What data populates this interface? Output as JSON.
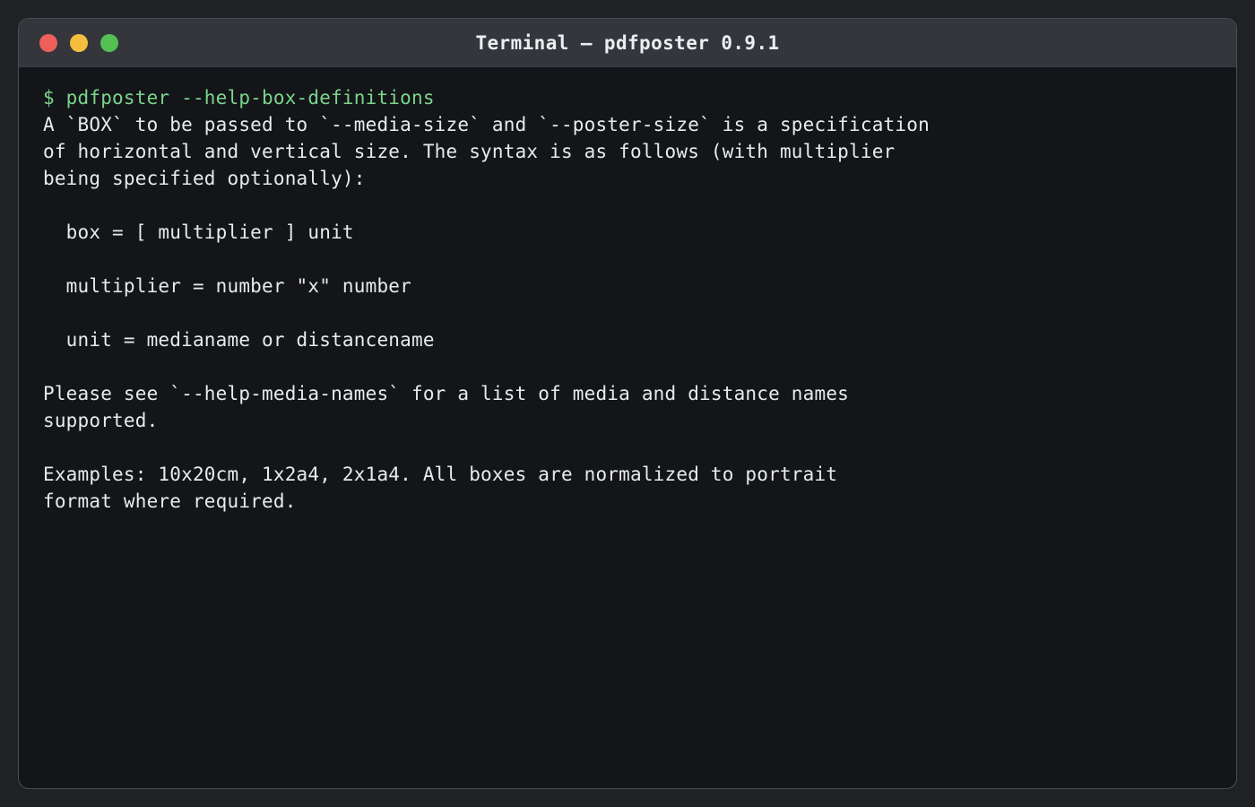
{
  "window": {
    "title": "Terminal — pdfposter 0.9.1"
  },
  "terminal": {
    "command": "$ pdfposter --help-box-definitions",
    "output": [
      "A `BOX` to be passed to `--media-size` and `--poster-size` is a specification",
      "of horizontal and vertical size. The syntax is as follows (with multiplier",
      "being specified optionally):",
      "",
      "  box = [ multiplier ] unit",
      "",
      "  multiplier = number \"x\" number",
      "",
      "  unit = medianame or distancename",
      "",
      "Please see `--help-media-names` for a list of media and distance names",
      "supported.",
      "",
      "Examples: 10x20cm, 1x2a4, 2x1a4. All boxes are normalized to portrait",
      "format where required."
    ]
  },
  "colors": {
    "background": "#141519",
    "titlebar": "#34363c",
    "prompt": "#7ad58c",
    "text": "#e8eaed",
    "close": "#ee5f5b",
    "minimize": "#f5bd3d",
    "maximize": "#55c054"
  }
}
